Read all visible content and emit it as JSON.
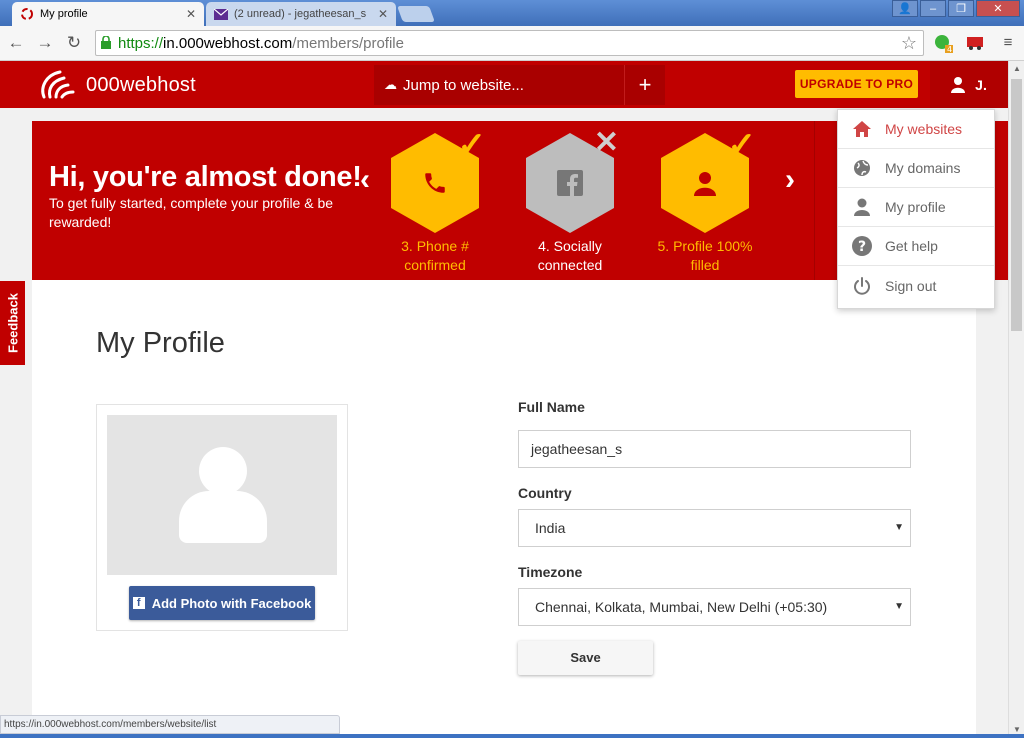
{
  "browser": {
    "tabs": [
      {
        "title": "My profile",
        "active": true
      },
      {
        "title": "(2 unread) - jegatheesan_s",
        "active": false
      }
    ],
    "url": {
      "scheme": "https://",
      "host": "in.000webhost.com",
      "path": "/members/profile"
    },
    "status_url": "https://in.000webhost.com/members/website/list",
    "extension_badge": "4"
  },
  "header": {
    "brand": "000webhost",
    "jump_placeholder": "Jump to website...",
    "add_label": "+",
    "upgrade_label": "UPGRADE TO PRO",
    "user_initial": "J."
  },
  "banner": {
    "title": "Hi, you're almost done!",
    "subtitle": "To get fully started, complete your profile & be rewarded!",
    "steps": [
      {
        "label": "3. Phone # confirmed",
        "done": true,
        "icon": "phone-icon"
      },
      {
        "label": "4. Socially connected",
        "done": false,
        "icon": "facebook-icon"
      },
      {
        "label": "5. Profile 100% filled",
        "done": true,
        "icon": "user-icon"
      }
    ]
  },
  "profile": {
    "page_title": "My Profile",
    "fb_button": "Add Photo with Facebook",
    "full_name_label": "Full Name",
    "full_name_value": "jegatheesan_s",
    "country_label": "Country",
    "country_value": "India",
    "timezone_label": "Timezone",
    "timezone_value": "Chennai, Kolkata, Mumbai, New Delhi (+05:30)",
    "save_label": "Save"
  },
  "feedback_label": "Feedback",
  "menu": {
    "items": [
      {
        "label": "My websites",
        "icon": "home-icon",
        "active": true
      },
      {
        "label": "My domains",
        "icon": "globe-icon",
        "active": false
      },
      {
        "label": "My profile",
        "icon": "user-icon",
        "active": false
      },
      {
        "label": "Get help",
        "icon": "question-icon",
        "active": false
      },
      {
        "label": "Sign out",
        "icon": "power-icon",
        "active": false
      }
    ]
  },
  "colors": {
    "brand_red": "#c00000",
    "accent_yellow": "#ffbc00",
    "facebook_blue": "#3b5b9a",
    "menu_active": "#d04545"
  }
}
